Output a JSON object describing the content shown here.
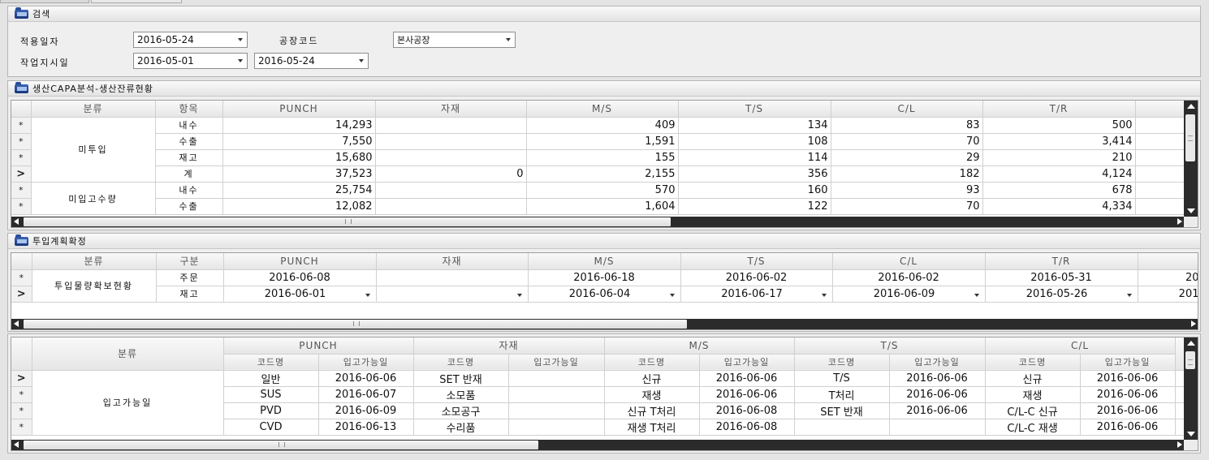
{
  "search": {
    "title": "검색",
    "apply_date_label": "적용일자",
    "apply_date": "2016-05-24",
    "plant_label": "공장코드",
    "plant": "본사공장",
    "work_date_label": "작업지시일",
    "work_from": "2016-05-01",
    "work_to": "2016-05-24"
  },
  "capa": {
    "title": "생산CAPA분석-생산잔류현황",
    "headers": [
      "분류",
      "항목",
      "PUNCH",
      "자재",
      "M/S",
      "T/S",
      "C/L",
      "T/R"
    ],
    "groups": [
      {
        "label": "미투입"
      },
      {
        "label": "미입고수량"
      }
    ],
    "rows": [
      {
        "sel": "*",
        "item": "내수",
        "punch": "14,293",
        "mat": "",
        "ms": "409",
        "ts": "134",
        "cl": "83",
        "tr": "500"
      },
      {
        "sel": "*",
        "item": "수출",
        "punch": "7,550",
        "mat": "",
        "ms": "1,591",
        "ts": "108",
        "cl": "70",
        "tr": "3,414"
      },
      {
        "sel": "*",
        "item": "재고",
        "punch": "15,680",
        "mat": "",
        "ms": "155",
        "ts": "114",
        "cl": "29",
        "tr": "210"
      },
      {
        "sel": ">",
        "item": "계",
        "punch": "37,523",
        "mat": "0",
        "ms": "2,155",
        "ts": "356",
        "cl": "182",
        "tr": "4,124"
      },
      {
        "sel": "*",
        "item": "내수",
        "punch": "25,754",
        "mat": "",
        "ms": "570",
        "ts": "160",
        "cl": "93",
        "tr": "678"
      },
      {
        "sel": "*",
        "item": "수출",
        "punch": "12,082",
        "mat": "",
        "ms": "1,604",
        "ts": "122",
        "cl": "70",
        "tr": "4,334"
      }
    ]
  },
  "plan": {
    "title": "투입계획확정",
    "headers": [
      "분류",
      "구분",
      "PUNCH",
      "자재",
      "M/S",
      "T/S",
      "C/L",
      "T/R"
    ],
    "group": "투입물량확보현황",
    "rows": [
      {
        "sel": "*",
        "type": "주문",
        "punch": "2016-06-08",
        "mat": "",
        "ms": "2016-06-18",
        "ts": "2016-06-02",
        "cl": "2016-06-02",
        "tr": "2016-05-31",
        "extra": "20"
      },
      {
        "sel": ">",
        "type": "재고",
        "punch": "2016-06-01",
        "mat": "",
        "ms": "2016-06-04",
        "ts": "2016-06-17",
        "cl": "2016-06-09",
        "tr": "2016-05-26",
        "extra": "201"
      }
    ]
  },
  "avail": {
    "header_class": "분류",
    "groups": [
      "PUNCH",
      "자재",
      "M/S",
      "T/S",
      "C/L"
    ],
    "sub_code": "코드명",
    "sub_date": "입고가능일",
    "label": "입고가능일",
    "rows": [
      {
        "sel": ">",
        "c1": "일반",
        "d1": "2016-06-06",
        "c2": "SET 반재",
        "d2": "",
        "c3": "신규",
        "d3": "2016-06-06",
        "c4": "T/S",
        "d4": "2016-06-06",
        "c5": "신규",
        "d5": "2016-06-06"
      },
      {
        "sel": "*",
        "c1": "SUS",
        "d1": "2016-06-07",
        "c2": "소모품",
        "d2": "",
        "c3": "재생",
        "d3": "2016-06-06",
        "c4": "T처리",
        "d4": "2016-06-06",
        "c5": "재생",
        "d5": "2016-06-06"
      },
      {
        "sel": "*",
        "c1": "PVD",
        "d1": "2016-06-09",
        "c2": "소모공구",
        "d2": "",
        "c3": "신규 T처리",
        "d3": "2016-06-08",
        "c4": "SET 반재",
        "d4": "2016-06-06",
        "c5": "C/L-C 신규",
        "d5": "2016-06-06"
      },
      {
        "sel": "*",
        "c1": "CVD",
        "d1": "2016-06-13",
        "c2": "수리품",
        "d2": "",
        "c3": "재생 T처리",
        "d3": "2016-06-08",
        "c4": "",
        "d4": "",
        "c5": "C/L-C 재생",
        "d5": "2016-06-06"
      }
    ]
  }
}
